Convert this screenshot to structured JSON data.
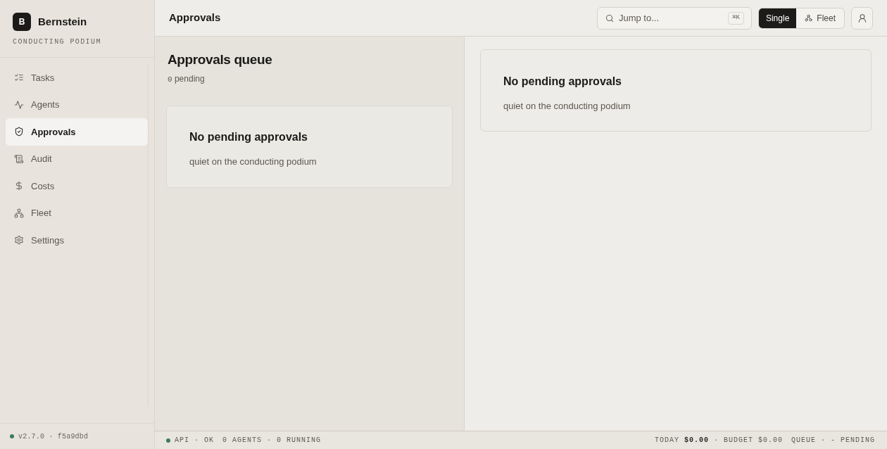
{
  "brand": {
    "logo_letter": "B",
    "name": "Bernstein",
    "tagline": "CONDUCTING PODIUM"
  },
  "sidebar": {
    "items": [
      {
        "label": "Tasks",
        "selected": false
      },
      {
        "label": "Agents",
        "selected": false
      },
      {
        "label": "Approvals",
        "selected": true
      },
      {
        "label": "Audit",
        "selected": false
      },
      {
        "label": "Costs",
        "selected": false
      },
      {
        "label": "Fleet",
        "selected": false
      },
      {
        "label": "Settings",
        "selected": false
      }
    ],
    "footer": "v2.7.0 · f5a9dbd"
  },
  "topbar": {
    "title": "Approvals",
    "search": {
      "placeholder": "Jump to...",
      "shortcut": "⌘K"
    },
    "view_switch": [
      {
        "label": "Single",
        "selected": true
      },
      {
        "label": "Fleet",
        "selected": false
      }
    ]
  },
  "queue": {
    "title": "Approvals queue",
    "pending_count": "0",
    "pending_label": "pending",
    "empty": {
      "title": "No pending approvals",
      "message": "quiet on the conducting podium"
    }
  },
  "detail": {
    "empty": {
      "title": "No pending approvals",
      "message": "quiet on the conducting podium"
    }
  },
  "status_bar": {
    "left": [
      "API · OK",
      "0 AGENTS · 0 RUNNING"
    ],
    "right": [
      "TODAY **$0.00** · BUDGET $0.00",
      "QUEUE · - PENDING"
    ]
  }
}
